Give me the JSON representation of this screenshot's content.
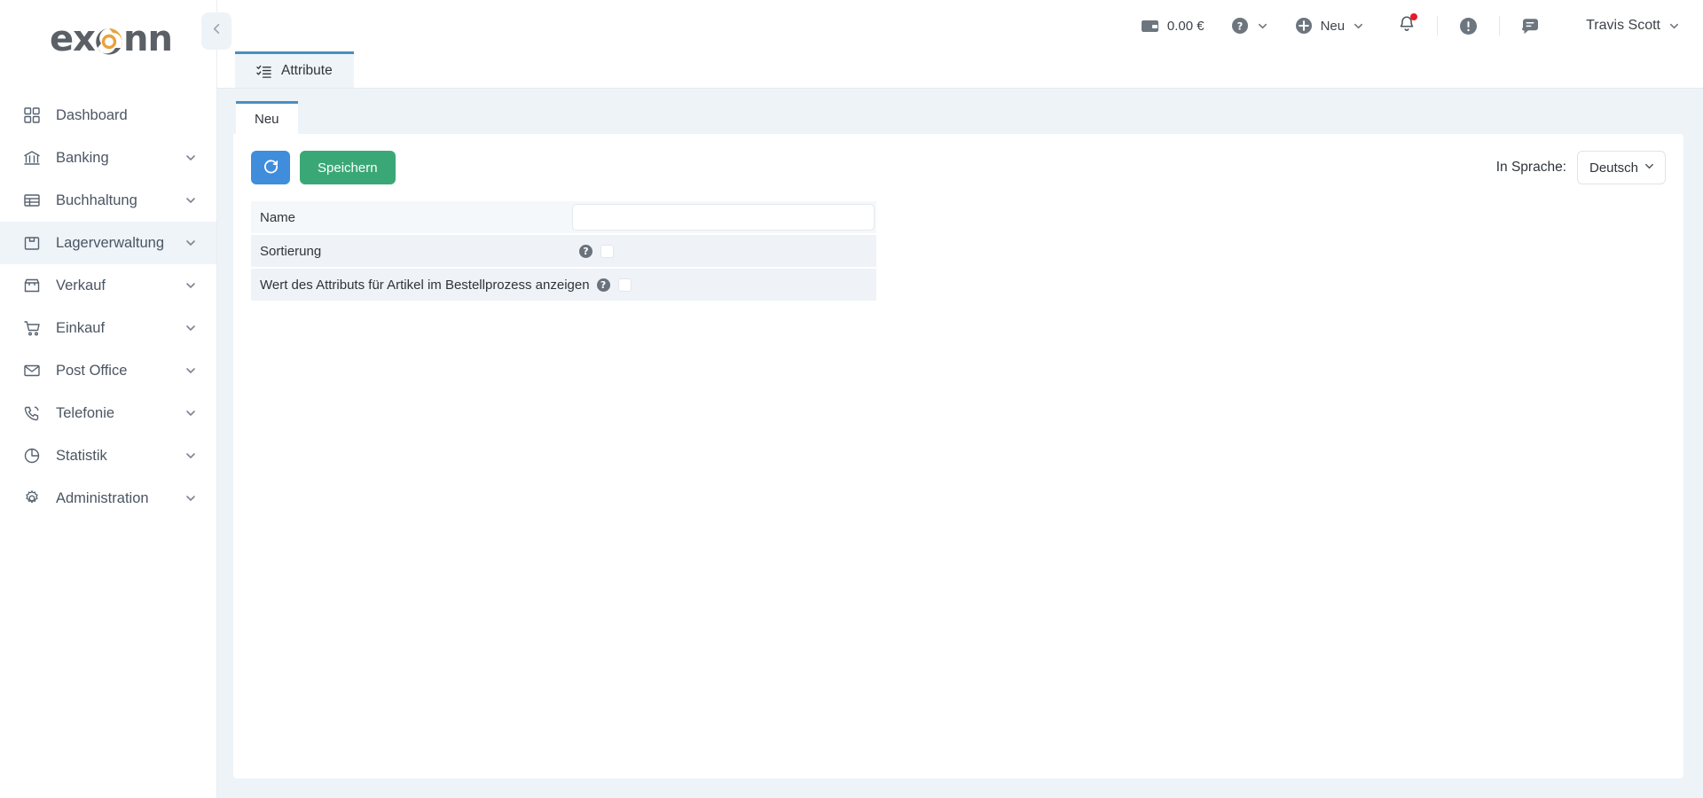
{
  "brand": {
    "name": "exonn",
    "accent_orange": "#e8a33d",
    "accent_gray": "#5a6066"
  },
  "sidebar": {
    "collapse_icon": "chevron-left-icon",
    "items": [
      {
        "label": "Dashboard",
        "icon": "grid-icon",
        "expandable": false,
        "active": false
      },
      {
        "label": "Banking",
        "icon": "bank-icon",
        "expandable": true,
        "active": false
      },
      {
        "label": "Buchhaltung",
        "icon": "ledger-icon",
        "expandable": true,
        "active": false
      },
      {
        "label": "Lagerverwaltung",
        "icon": "box-icon",
        "expandable": true,
        "active": true
      },
      {
        "label": "Verkauf",
        "icon": "store-icon",
        "expandable": true,
        "active": false
      },
      {
        "label": "Einkauf",
        "icon": "cart-icon",
        "expandable": true,
        "active": false
      },
      {
        "label": "Post Office",
        "icon": "envelope-icon",
        "expandable": true,
        "active": false
      },
      {
        "label": "Telefonie",
        "icon": "phone-icon",
        "expandable": true,
        "active": false
      },
      {
        "label": "Statistik",
        "icon": "pie-chart-icon",
        "expandable": true,
        "active": false
      },
      {
        "label": "Administration",
        "icon": "gear-icon",
        "expandable": true,
        "active": false
      }
    ]
  },
  "topbar": {
    "wallet_icon": "wallet-icon",
    "balance": "0.00 €",
    "help_icon": "question-circle-icon",
    "new_icon": "plus-circle-icon",
    "new_label": "Neu",
    "notifications_icon": "bell-icon",
    "notifications_has_badge": true,
    "badge_color": "#e8192c",
    "alerts_icon": "exclamation-circle-icon",
    "messages_icon": "chat-bubble-icon",
    "user_name": "Travis Scott",
    "user_chevron_icon": "chevron-down-icon"
  },
  "tabs": [
    {
      "label": "Attribute",
      "icon": "checklist-icon",
      "active": true
    }
  ],
  "subtabs": [
    {
      "label": "Neu",
      "active": true
    }
  ],
  "toolbar": {
    "refresh_icon": "refresh-icon",
    "refresh_color": "#3f8ddb",
    "save_label": "Speichern",
    "save_color": "#3aa876",
    "language_label": "In Sprache:",
    "language_value": "Deutsch",
    "language_chevron_icon": "chevron-down-icon"
  },
  "form": {
    "rows": [
      {
        "label": "Name",
        "type": "text",
        "value": "",
        "placeholder": "",
        "has_help": false
      },
      {
        "label": "Sortierung",
        "type": "checkbox",
        "checked": false,
        "has_help": true,
        "help_icon": "question-circle-icon"
      },
      {
        "label": "Wert des Attributs für Artikel im Bestellprozess anzeigen",
        "type": "checkbox",
        "checked": false,
        "has_help": true,
        "help_icon": "question-circle-icon"
      }
    ]
  }
}
